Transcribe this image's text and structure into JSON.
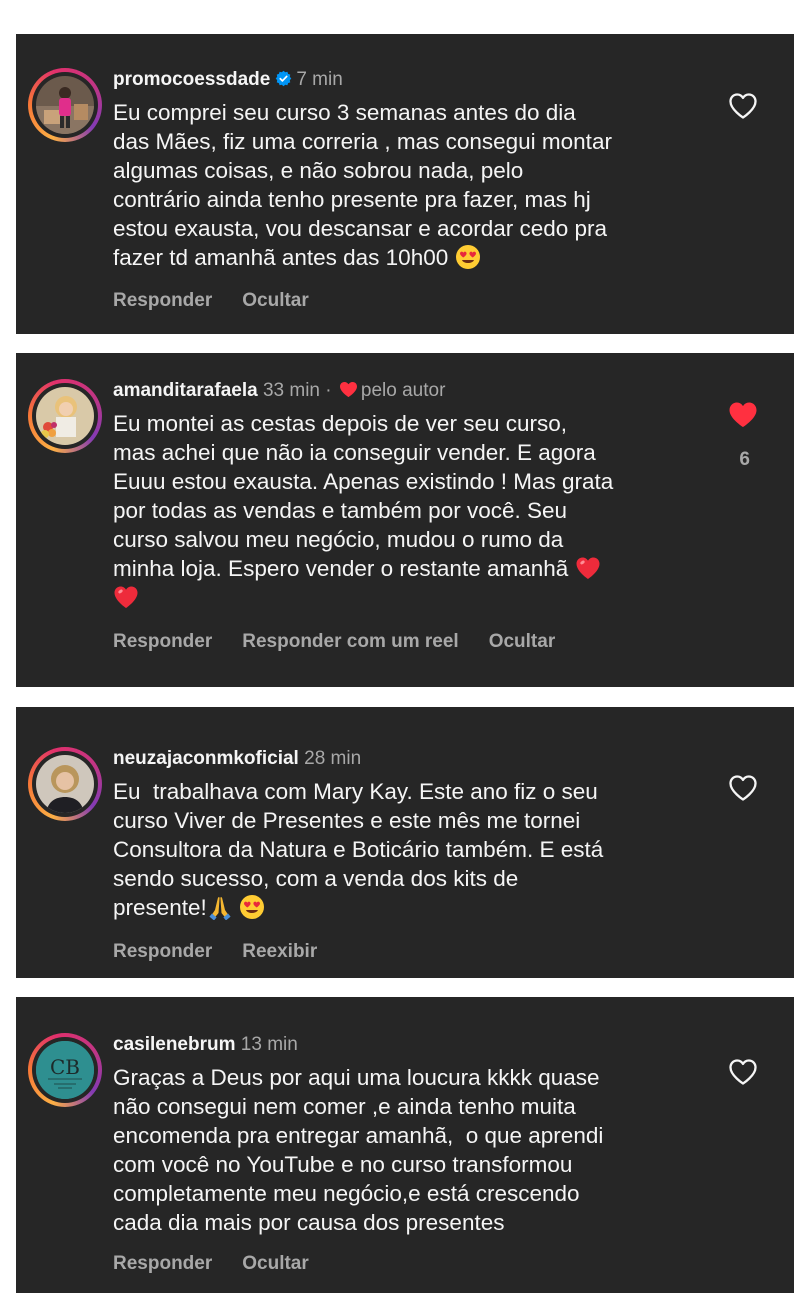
{
  "comments": [
    {
      "username": "promocoessdade",
      "verified": true,
      "time": "7 min",
      "author_like_label": "",
      "lines": [
        "Eu comprei seu curso 3 semanas antes do dia",
        "das Mães, fiz uma correria , mas consegui montar",
        "algumas coisas, e não sobrou nada, pelo",
        "contrário ainda tenho presente pra fazer, mas hj",
        "estou exausta, vou descansar e acordar cedo pra",
        "fazer td amanhã antes das 10h00"
      ],
      "actions": [
        "Responder",
        "Ocultar"
      ],
      "liked": false,
      "like_count": ""
    },
    {
      "username": "amanditarafaela",
      "verified": false,
      "time": "33 min",
      "separator": "·",
      "author_like_label": "pelo autor",
      "lines": [
        "Eu montei as cestas depois de ver seu curso,",
        "mas achei que não ia conseguir vender. E agora",
        "Euuu estou exausta. Apenas existindo ! Mas grata",
        "por todas as vendas e também por você. Seu",
        "curso salvou meu negócio, mudou o rumo da",
        "minha loja. Espero vender o restante amanhã"
      ],
      "actions": [
        "Responder",
        "Responder com um reel",
        "Ocultar"
      ],
      "liked": true,
      "like_count": "6"
    },
    {
      "username": "neuzajaconmkoficial",
      "verified": false,
      "time": "28 min",
      "author_like_label": "",
      "lines": [
        "Eu  trabalhava com Mary Kay. Este ano fiz o seu",
        "curso Viver de Presentes e este mês me tornei",
        "Consultora da Natura e Boticário também. E está",
        "sendo sucesso, com a venda dos kits de",
        "presente!"
      ],
      "actions": [
        "Responder",
        "Reexibir"
      ],
      "liked": false,
      "like_count": ""
    },
    {
      "username": "casilenebrum",
      "verified": false,
      "time": "13 min",
      "author_like_label": "",
      "lines": [
        "Graças a Deus por aqui uma loucura kkkk quase",
        "não consegui nem comer ,e ainda tenho muita",
        "encomenda pra entregar amanhã,  o que aprendi",
        "com você no YouTube e no curso transformou",
        "completamente meu negócio,e está crescendo",
        "cada dia mais por causa dos presentes"
      ],
      "actions": [
        "Responder",
        "Ocultar"
      ],
      "liked": false,
      "like_count": "",
      "avatar_text": "CB"
    }
  ],
  "colors": {
    "card_bg": "#262626",
    "text_primary": "#f5f5f5",
    "text_secondary": "#a8a8a8",
    "verified_blue": "#0095f6",
    "like_red": "#ff3040"
  }
}
